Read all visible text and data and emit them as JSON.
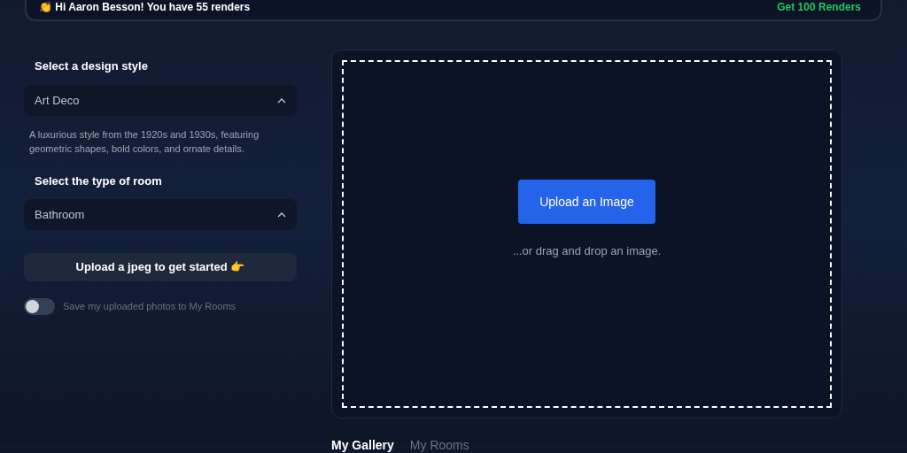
{
  "banner": {
    "greeting": "👏 Hi Aaron Besson! You have 55 renders",
    "action": "Get 100 Renders"
  },
  "style_select": {
    "label": "Select a design style",
    "value": "Art Deco",
    "expanded": true,
    "description": "A luxurious style from the 1920s and 1930s, featuring geometric shapes, bold colors, and ornate details."
  },
  "room_select": {
    "label": "Select the type of room",
    "value": "Bathroom",
    "expanded": true
  },
  "upload_hint_button": "Upload a jpeg to get started 👉",
  "save_toggle": {
    "label": "Save my uploaded photos to My Rooms",
    "on": false
  },
  "dropzone": {
    "button": "Upload an Image",
    "hint": "...or drag and drop an image."
  },
  "tabs": [
    {
      "label": "My Gallery",
      "selected": true
    },
    {
      "label": "My Rooms",
      "selected": false
    }
  ]
}
